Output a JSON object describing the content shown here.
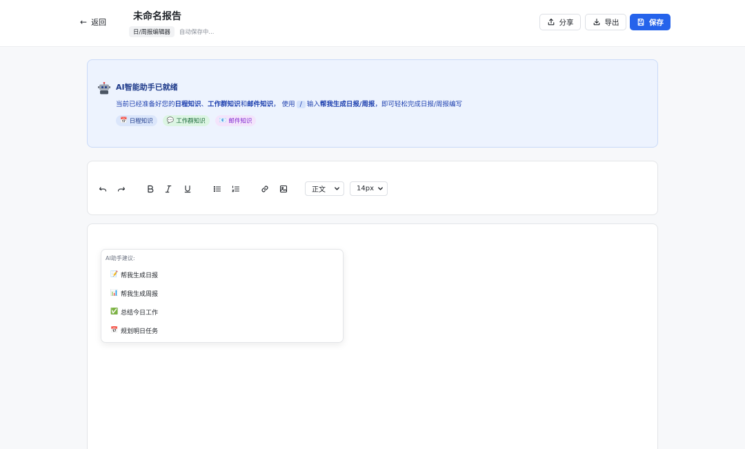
{
  "header": {
    "back_label": "返回",
    "title": "未命名报告",
    "tag": "日/周报编辑器",
    "autosave": "自动保存中...",
    "share_label": "分享",
    "export_label": "导出",
    "save_label": "保存"
  },
  "ai_card": {
    "title": "AI智能助手已就绪",
    "desc_prefix": "当前已经准备好您的",
    "desc_k1": "日程知识",
    "desc_sep1": "、",
    "desc_k2": "工作群知识",
    "desc_and": "和",
    "desc_k3": "邮件知识",
    "desc_use": "， 使用",
    "slash": "/",
    "desc_input": "输入",
    "desc_cmd": "帮我生成日报/周报",
    "desc_suffix": "，即可轻松完成日报/周报编写",
    "chips": [
      {
        "icon": "📅",
        "label": "日程知识"
      },
      {
        "icon": "💬",
        "label": "工作群知识"
      },
      {
        "icon": "📧",
        "label": "邮件知识"
      }
    ]
  },
  "toolbar": {
    "block_type": "正文",
    "font_size": "14px"
  },
  "suggestions": {
    "title": "AI助手建议:",
    "items": [
      {
        "icon": "📝",
        "label": "帮我生成日报"
      },
      {
        "icon": "📊",
        "label": "帮我生成周报"
      },
      {
        "icon": "✅",
        "label": "总结今日工作"
      },
      {
        "icon": "📅",
        "label": "规划明日任务"
      }
    ]
  },
  "colors": {
    "accent": "#2563eb",
    "ai_card_bg": "#edf3fe",
    "ai_text": "#1e40af"
  }
}
